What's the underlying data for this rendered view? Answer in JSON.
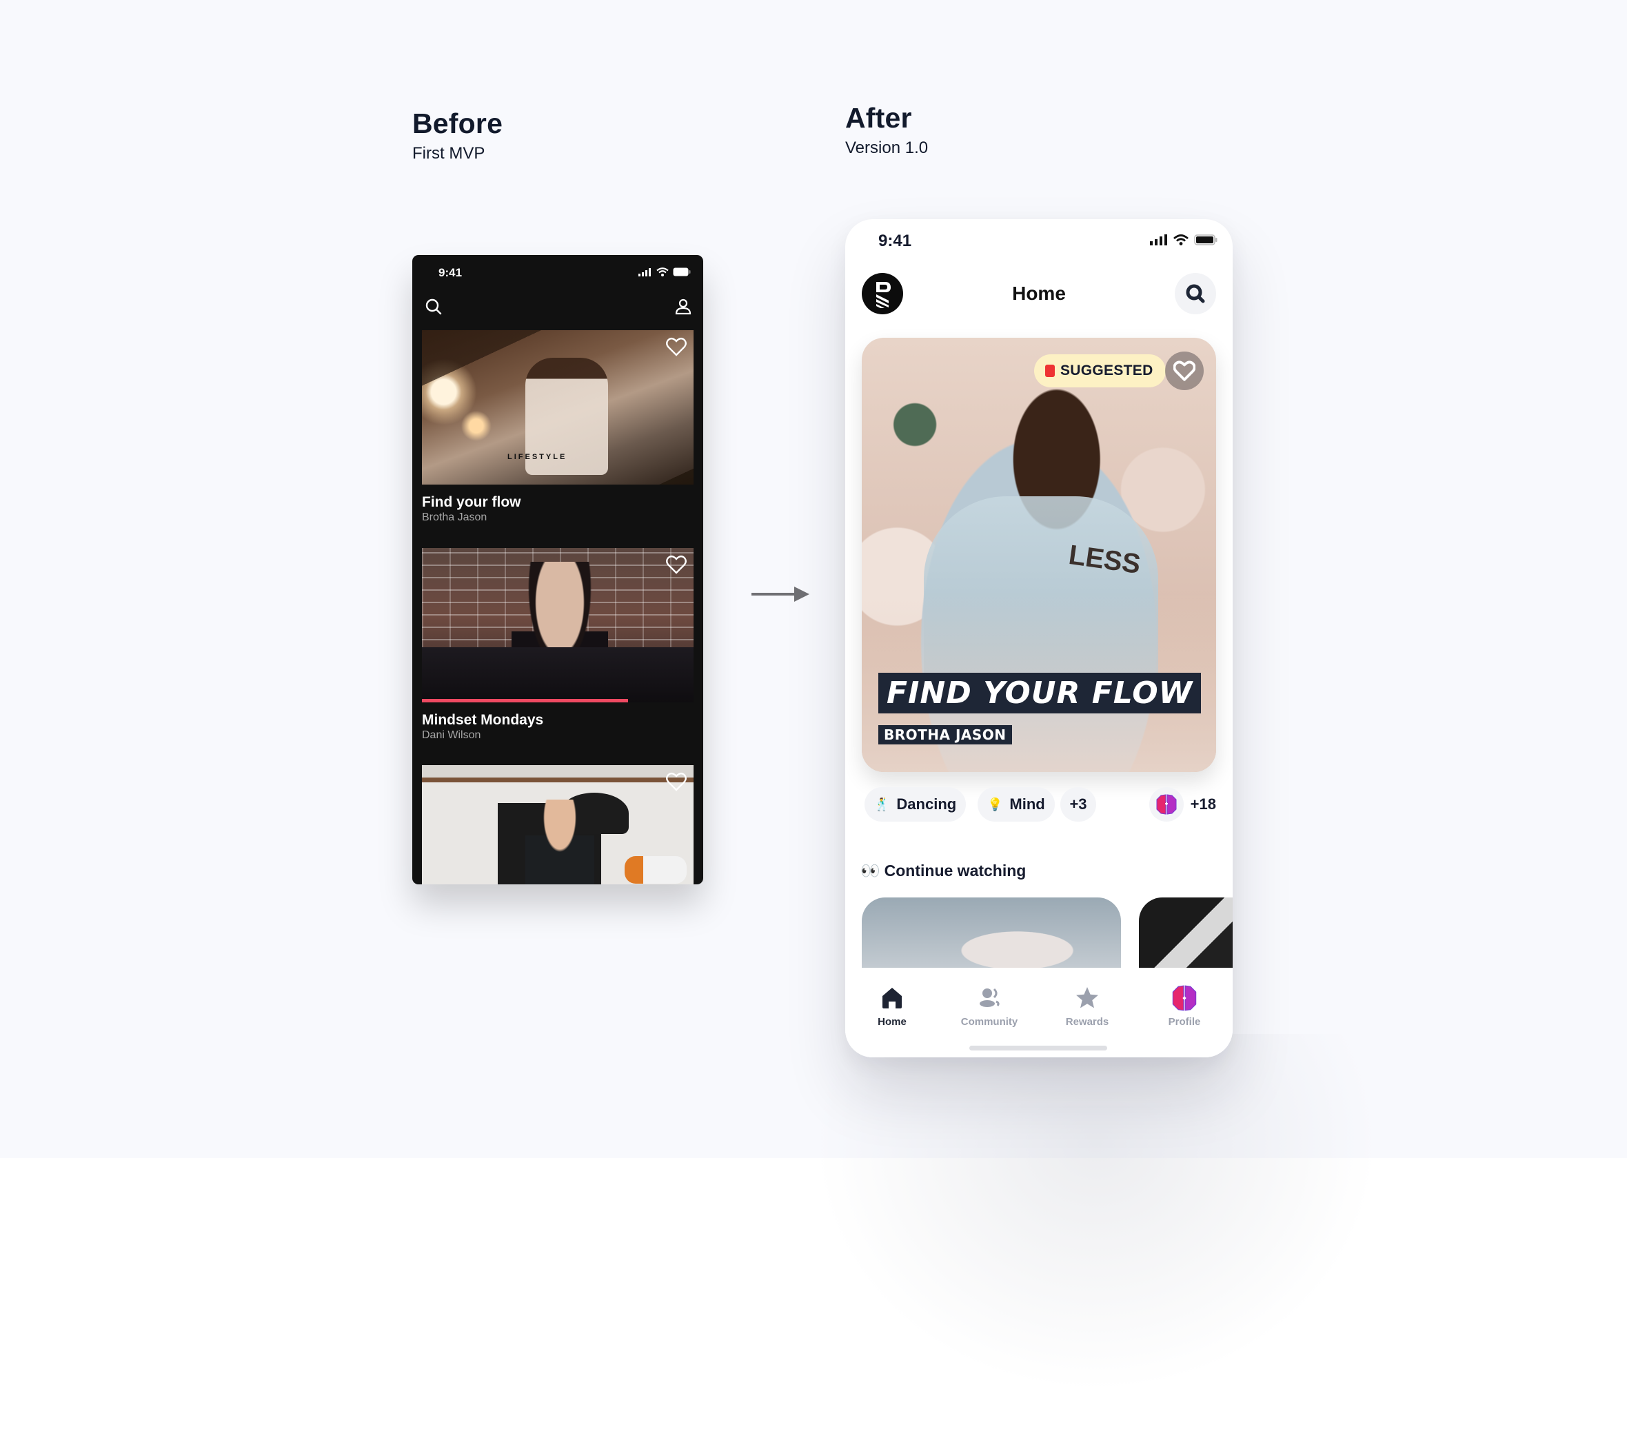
{
  "before": {
    "heading": "Before",
    "subheading": "First MVP",
    "status_time": "9:41",
    "icons": {
      "search": "search-icon",
      "profile": "user-icon"
    },
    "cards": [
      {
        "title": "Find your flow",
        "author": "Brotha Jason",
        "overlay_text": "LIFESTYLE",
        "favorited": false
      },
      {
        "title": "Mindset Mondays",
        "author": "Dani Wilson",
        "progress": 0.76,
        "favorited": false
      },
      {
        "title": "",
        "author": "",
        "favorited": false
      }
    ],
    "colors": {
      "background": "#111111",
      "progress": "#ef4a62"
    }
  },
  "transition_arrow": "arrow-right-icon",
  "after": {
    "heading": "After",
    "subheading": "Version 1.0",
    "status_time": "9:41",
    "header": {
      "title": "Home"
    },
    "hero": {
      "badge": "SUGGESTED",
      "title": "FIND YOUR FLOW",
      "author": "BROTHA JASON"
    },
    "chips": [
      {
        "emoji": "🕺",
        "label": "Dancing"
      },
      {
        "emoji": "💡",
        "label": "Mind"
      },
      {
        "label": "+3"
      }
    ],
    "brain_count": "+18",
    "continue_watching": {
      "emoji": "👀",
      "title": "Continue watching"
    },
    "tabs": [
      {
        "label": "Home",
        "icon": "home-icon",
        "active": true
      },
      {
        "label": "Community",
        "icon": "community-icon",
        "active": false
      },
      {
        "label": "Rewards",
        "icon": "star-icon",
        "active": false
      },
      {
        "label": "Profile",
        "icon": "brain-icon",
        "active": false
      }
    ],
    "colors": {
      "badge_bg": "#fdf1c4",
      "text_dark": "#161b2e",
      "tab_inactive": "#9ba0ad",
      "brain_pink": "#e6266e",
      "brain_purple": "#8e2cc9"
    }
  }
}
